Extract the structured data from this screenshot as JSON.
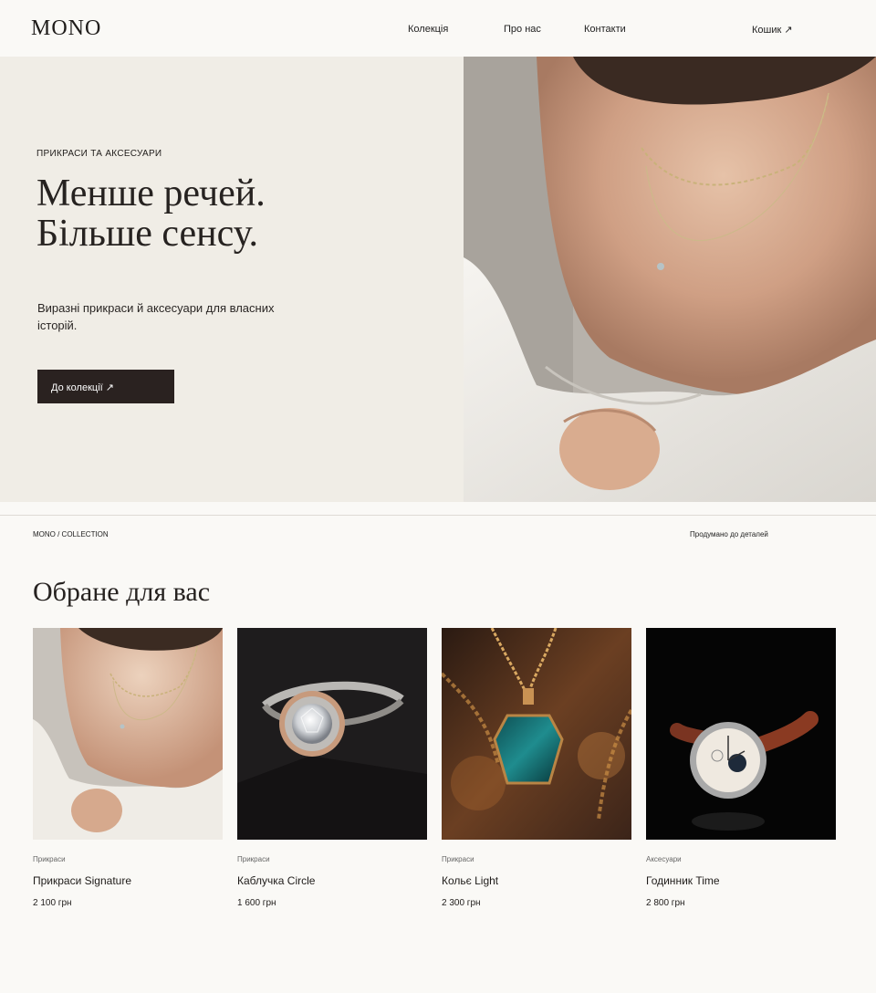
{
  "brand": {
    "logo": "MONO"
  },
  "nav": {
    "items": [
      {
        "label": "Колекція"
      },
      {
        "label": "Про нас"
      },
      {
        "label": "Контакти"
      }
    ],
    "cart_label": "Кошик ↗"
  },
  "hero": {
    "eyebrow": "ПРИКРАСИ ТА АКСЕСУАРИ",
    "title_line1": "Менше речей.",
    "title_line2": "Більше сенсу.",
    "subtitle": "Виразні прикраси й аксесуари для власних історій.",
    "cta_label": "До колекції ↗"
  },
  "meta": {
    "left": "MONO / COLLECTION",
    "right": "Продумано до деталей"
  },
  "featured": {
    "title": "Обране для вас",
    "products": [
      {
        "category": "Прикраси",
        "name": "Прикраси Signature",
        "price": "2 100 грн"
      },
      {
        "category": "Прикраси",
        "name": "Каблучка Circle",
        "price": "1 600 грн"
      },
      {
        "category": "Прикраси",
        "name": "Кольє Light",
        "price": "2 300 грн"
      },
      {
        "category": "Аксесуари",
        "name": "Годинник Time",
        "price": "2 800 грн"
      }
    ]
  },
  "colors": {
    "background": "#faf9f6",
    "hero_panel": "#f0ede6",
    "button": "#2a2220",
    "text": "#1f1c1a"
  }
}
